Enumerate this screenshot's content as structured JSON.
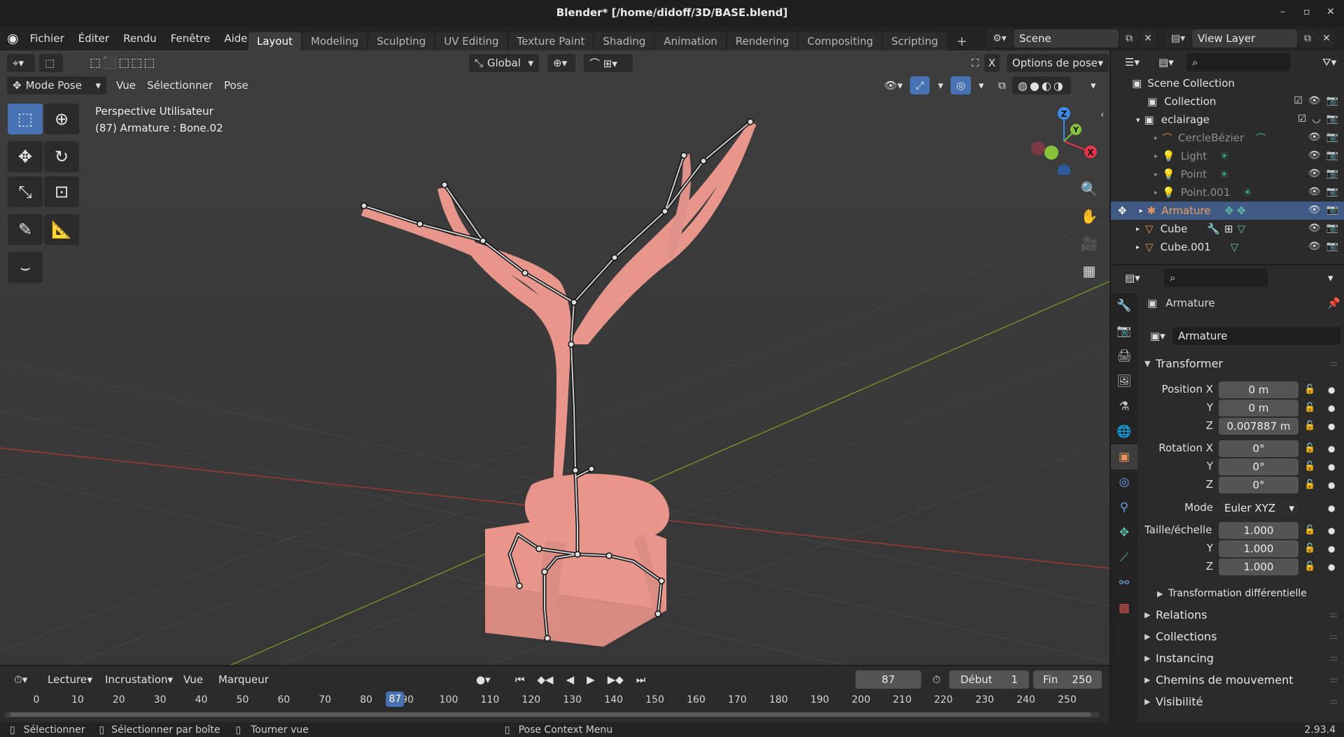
{
  "window": {
    "title": "Blender* [/home/didoff/3D/BASE.blend]",
    "minimize": "–",
    "maximize": "▫",
    "close": "✕"
  },
  "menu": [
    "Fichier",
    "Éditer",
    "Rendu",
    "Fenêtre",
    "Aide"
  ],
  "workspaces": [
    "Layout",
    "Modeling",
    "Sculpting",
    "UV Editing",
    "Texture Paint",
    "Shading",
    "Animation",
    "Rendering",
    "Compositing",
    "Scripting"
  ],
  "workspace_add": "+",
  "scene": {
    "name": "Scene",
    "view_layer": "View Layer"
  },
  "viewport": {
    "orientation": "Global",
    "pose_options": "Options de pose",
    "mode": "Mode Pose",
    "menus": [
      "Vue",
      "Sélectionner",
      "Pose"
    ],
    "overlay_line1": "Perspective Utilisateur",
    "overlay_line2": "(87) Armature : Bone.02",
    "gizmo": {
      "z": "Z",
      "y": "Y",
      "x": "X"
    },
    "xray_label": "X"
  },
  "timeline": {
    "menus": [
      "Lecture",
      "Incrustation",
      "Vue",
      "Marqueur"
    ],
    "current_frame": "87",
    "start_label": "Début",
    "start": "1",
    "end_label": "Fin",
    "end": "250",
    "ruler": [
      "0",
      "10",
      "20",
      "30",
      "40",
      "50",
      "60",
      "70",
      "80",
      "90",
      "100",
      "110",
      "120",
      "130",
      "140",
      "150",
      "160",
      "170",
      "180",
      "190",
      "200",
      "210",
      "220",
      "230",
      "240",
      "250"
    ],
    "playhead": "87"
  },
  "status": {
    "select": "Sélectionner",
    "box_select": "Sélectionner par boîte",
    "rotate_view": "Tourner vue",
    "context_menu": "Pose Context Menu",
    "version": "2.93.4"
  },
  "outliner": {
    "root": "Scene Collection",
    "items": [
      {
        "name": "Collection",
        "dim": false
      },
      {
        "name": "eclairage",
        "dim": false
      },
      {
        "name": "CercleBézier",
        "dim": true
      },
      {
        "name": "Light",
        "dim": true
      },
      {
        "name": "Point",
        "dim": true
      },
      {
        "name": "Point.001",
        "dim": true
      },
      {
        "name": "Armature",
        "dim": false
      },
      {
        "name": "Cube",
        "dim": false
      },
      {
        "name": "Cube.001",
        "dim": false
      }
    ]
  },
  "properties": {
    "object_name": "Armature",
    "data_name": "Armature",
    "panel_transform": "Transformer",
    "position_label": "Position X",
    "rotation_label": "Rotation X",
    "scale_label": "Taille/échelle",
    "y_label": "Y",
    "z_label": "Z",
    "position": [
      "0 m",
      "0 m",
      "0.007887 m"
    ],
    "rotation": [
      "0°",
      "0°",
      "0°"
    ],
    "mode_label": "Mode",
    "mode_value": "Euler XYZ",
    "scale": [
      "1.000",
      "1.000",
      "1.000"
    ],
    "delta": "Transformation différentielle",
    "panels": [
      "Relations",
      "Collections",
      "Instancing",
      "Chemins de mouvement",
      "Visibilité"
    ]
  },
  "colors": {
    "accent": "#4772b3",
    "mesh": "#e8968c",
    "axis_x": "#c0392b",
    "axis_y": "#7aa228",
    "gizmo_x": "#e8354b",
    "gizmo_y": "#86c23a",
    "gizmo_z": "#3d8ae8"
  }
}
